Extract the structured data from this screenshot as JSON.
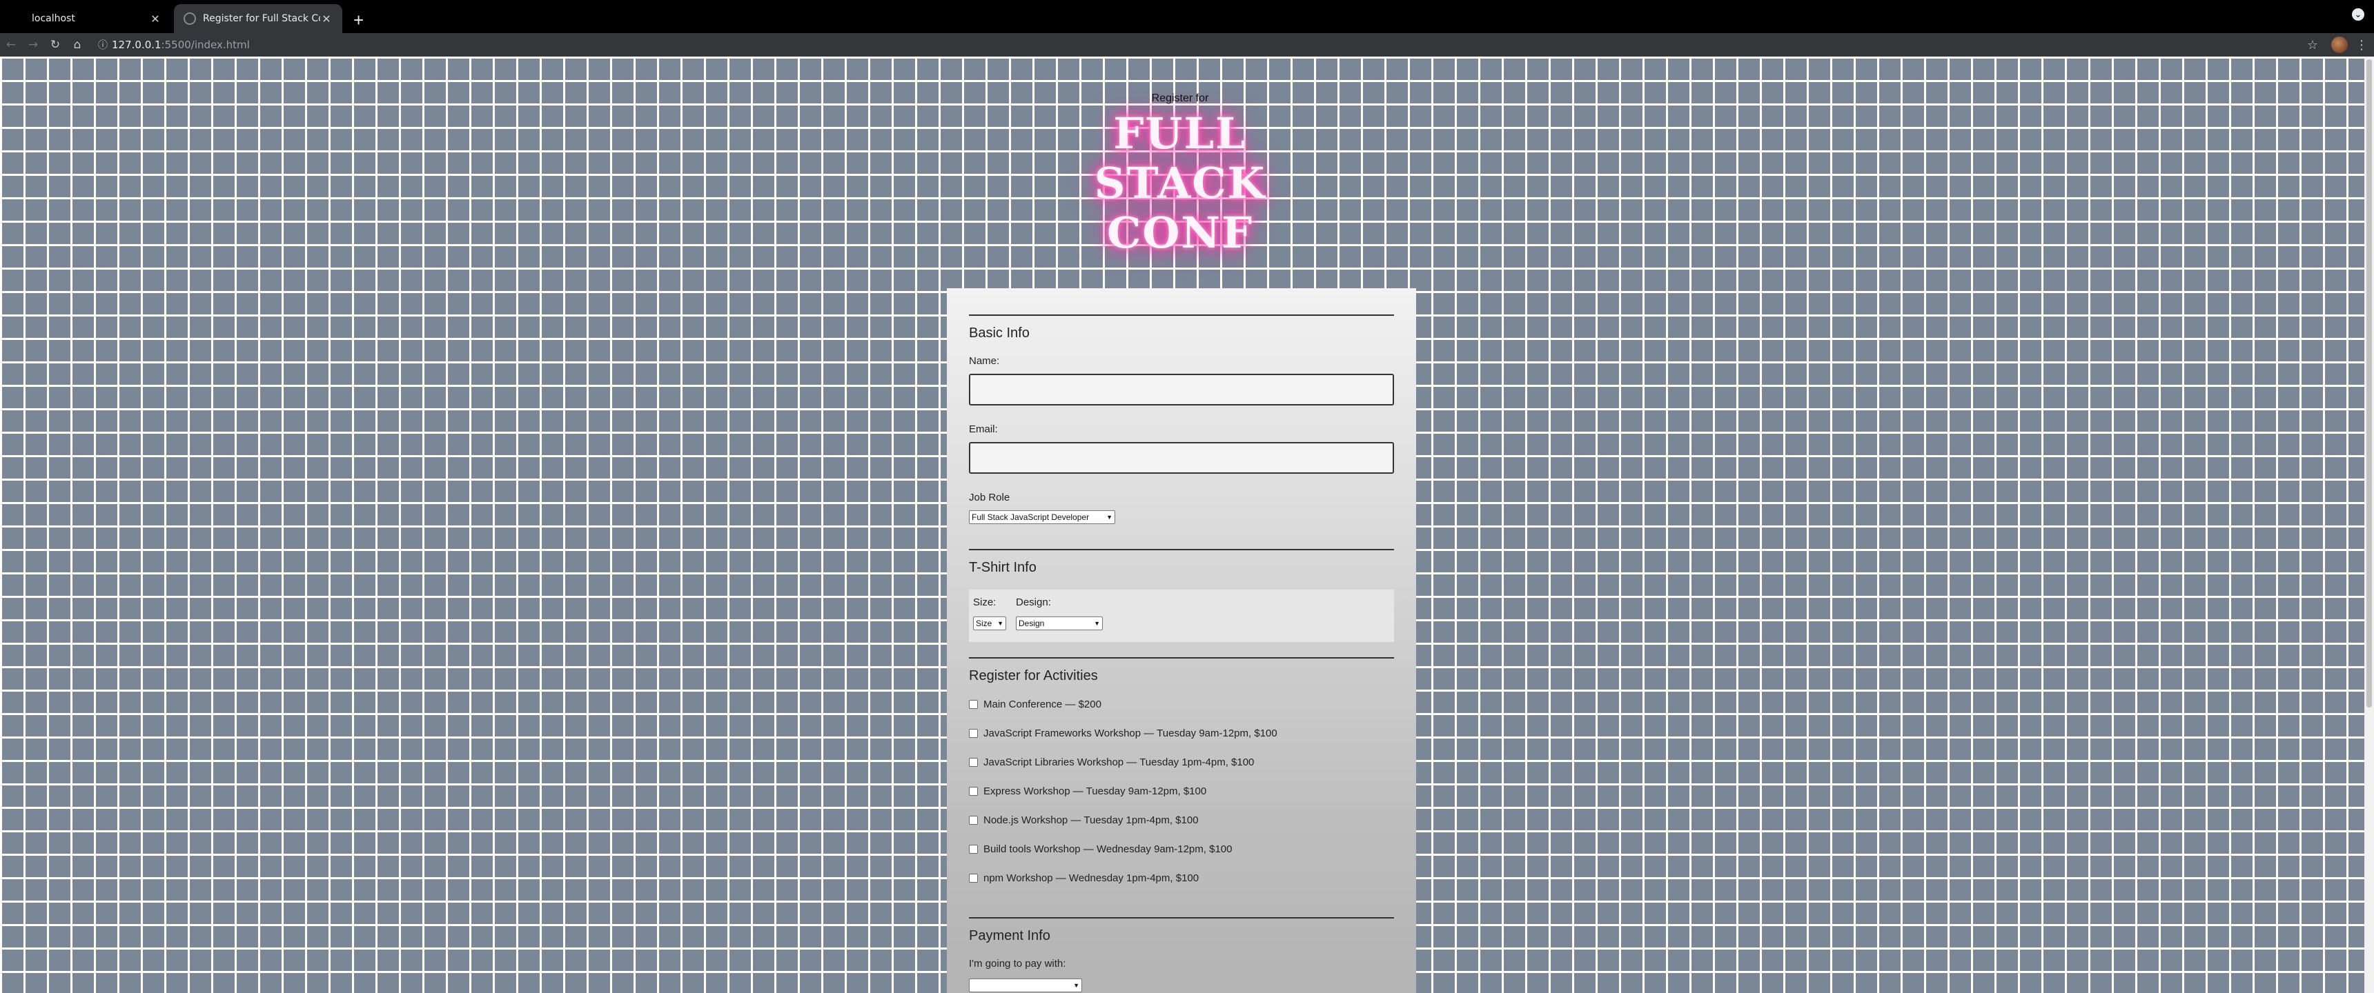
{
  "browser": {
    "tabs": [
      {
        "title": "localhost",
        "active": false
      },
      {
        "title": "Register for Full Stack Conf",
        "active": true
      }
    ],
    "new_tab_label": "+",
    "url_host": "127.0.0.1",
    "url_rest": ":5500/index.html"
  },
  "header": {
    "register_for": "Register for",
    "logo_lines": [
      "FULL",
      "STACK",
      "CONF"
    ]
  },
  "form": {
    "basic_info": {
      "legend": "Basic Info",
      "name_label": "Name:",
      "name_value": "",
      "email_label": "Email:",
      "email_value": "",
      "job_role_label": "Job Role",
      "job_role_selected": "Full Stack JavaScript Developer"
    },
    "tshirt_info": {
      "legend": "T-Shirt Info",
      "size_label": "Size:",
      "size_selected": "Size",
      "design_label": "Design:",
      "design_selected": "Design"
    },
    "activities": {
      "legend": "Register for Activities",
      "items": [
        {
          "label": "Main Conference — $200",
          "checked": false
        },
        {
          "label": "JavaScript Frameworks Workshop — Tuesday 9am-12pm, $100",
          "checked": false
        },
        {
          "label": "JavaScript Libraries Workshop — Tuesday 1pm-4pm, $100",
          "checked": false
        },
        {
          "label": "Express Workshop — Tuesday 9am-12pm, $100",
          "checked": false
        },
        {
          "label": "Node.js Workshop — Tuesday 1pm-4pm, $100",
          "checked": false
        },
        {
          "label": "Build tools Workshop — Wednesday 9am-12pm, $100",
          "checked": false
        },
        {
          "label": "npm Workshop — Wednesday 1pm-4pm, $100",
          "checked": false
        }
      ]
    },
    "payment_info": {
      "legend": "Payment Info",
      "pay_with_label": "I'm going to pay with:"
    }
  },
  "colors": {
    "brick": "#7a8797",
    "mortar": "#ffffff",
    "neon": "#ff2fa6"
  }
}
